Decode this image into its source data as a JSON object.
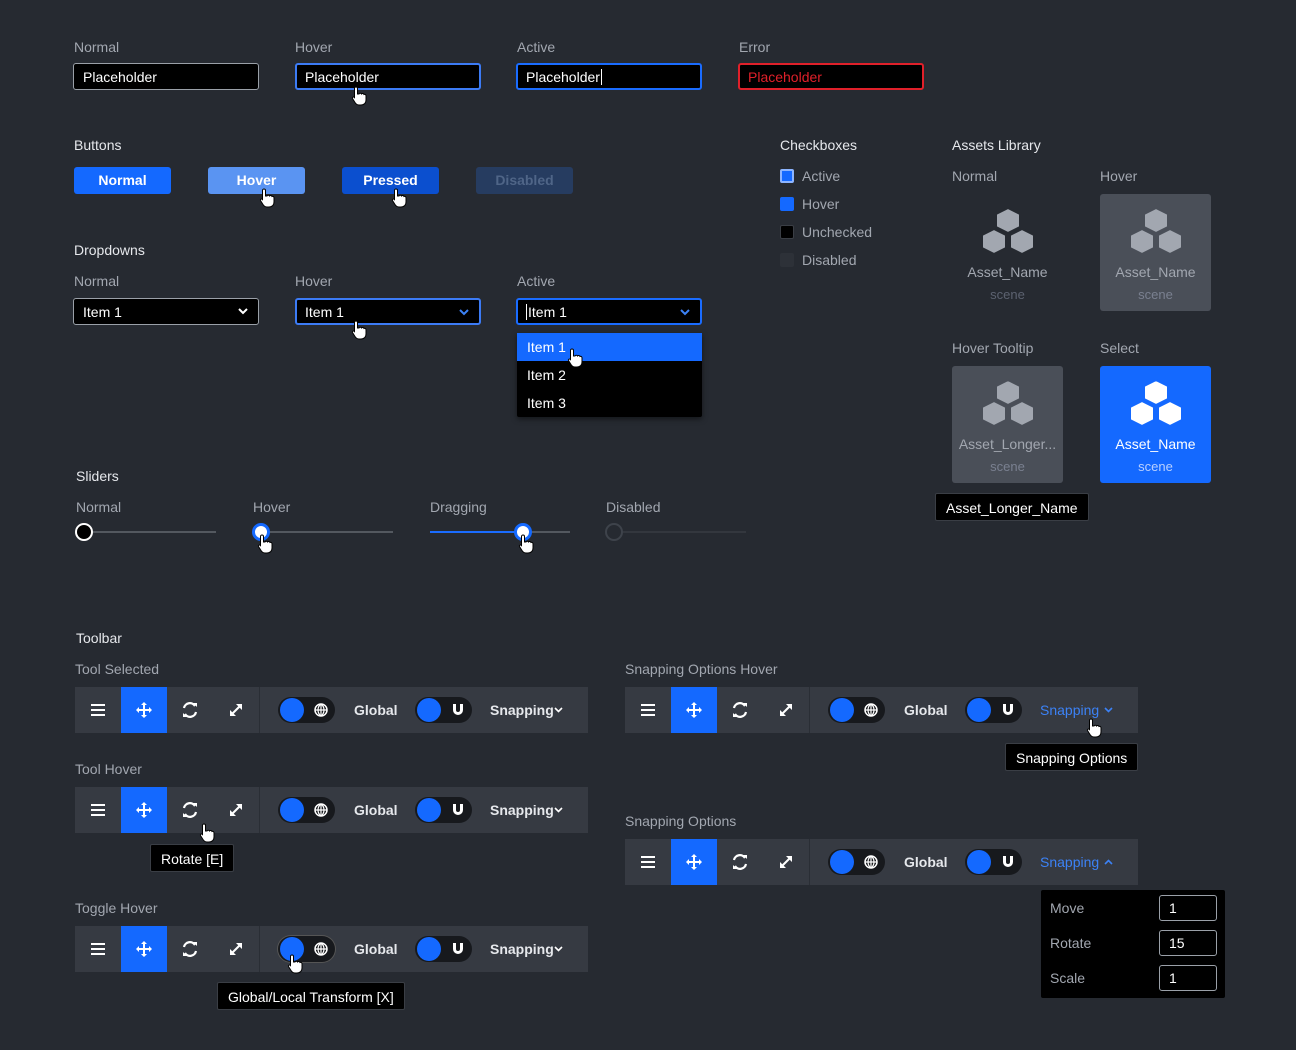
{
  "inputs": {
    "states": [
      "Normal",
      "Hover",
      "Active",
      "Error"
    ],
    "placeholder": "Placeholder"
  },
  "buttons": {
    "section": "Buttons",
    "labels": [
      "Normal",
      "Hover",
      "Pressed",
      "Disabled"
    ]
  },
  "dropdowns": {
    "section": "Dropdowns",
    "states": [
      "Normal",
      "Hover",
      "Active"
    ],
    "value": "Item 1",
    "options": [
      "Item 1",
      "Item 2",
      "Item 3"
    ]
  },
  "checkboxes": {
    "section": "Checkboxes",
    "items": [
      "Active",
      "Hover",
      "Unchecked",
      "Disabled"
    ]
  },
  "assets": {
    "section": "Assets Library",
    "states": [
      "Normal",
      "Hover",
      "Hover Tooltip",
      "Select"
    ],
    "name": "Asset_Name",
    "long_name": "Asset_Longer...",
    "type": "scene",
    "tooltip": "Asset_Longer_Name"
  },
  "sliders": {
    "section": "Sliders",
    "states": [
      "Normal",
      "Hover",
      "Dragging",
      "Disabled"
    ],
    "values": [
      0,
      0,
      0.66,
      0
    ]
  },
  "toolbar": {
    "section": "Toolbar",
    "titles": [
      "Tool Selected",
      "Tool Hover",
      "Toggle Hover",
      "Snapping Options Hover",
      "Snapping Options"
    ],
    "global_label": "Global",
    "snapping_label": "Snapping",
    "tooltips": {
      "rotate": "Rotate [E]",
      "transform": "Global/Local Transform [X]",
      "snapping": "Snapping Options"
    },
    "snap_panel": {
      "move_label": "Move",
      "move_value": "1",
      "rotate_label": "Rotate",
      "rotate_value": "15",
      "scale_label": "Scale",
      "scale_value": "1"
    }
  },
  "colors": {
    "accent": "#1469ff",
    "error": "#e0202a",
    "background": "#262a31"
  },
  "icons": [
    "hamburger-icon",
    "move-icon",
    "rotate-icon",
    "scale-icon",
    "globe-icon",
    "magnet-icon",
    "chevron-down-icon",
    "chevron-up-icon",
    "cubes-icon",
    "hand-cursor-icon"
  ]
}
